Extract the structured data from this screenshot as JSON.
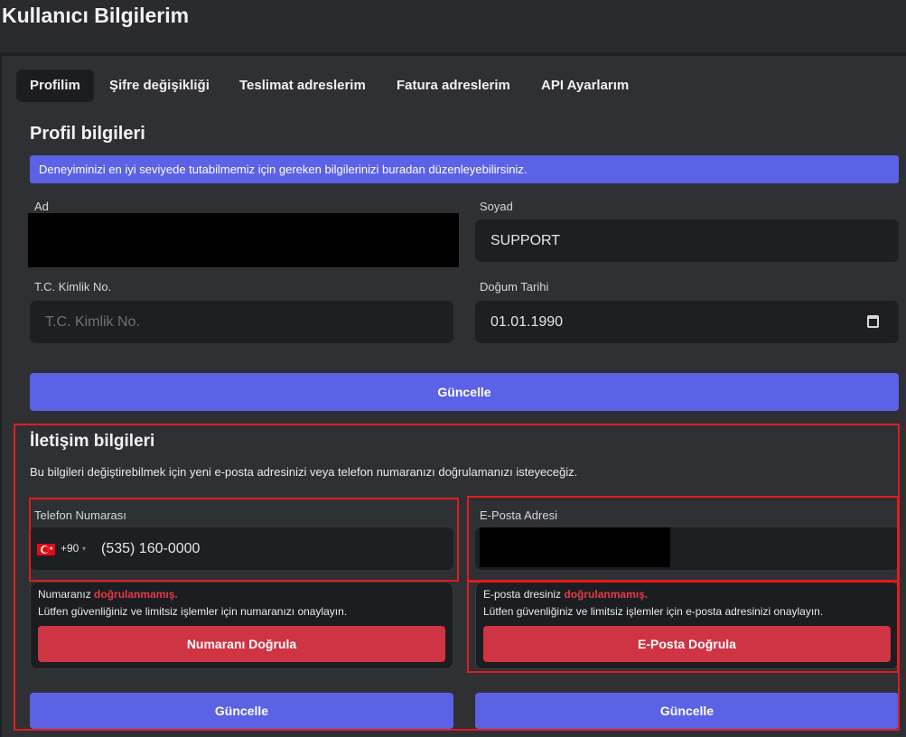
{
  "page": {
    "title": "Kullanıcı Bilgilerim"
  },
  "tabs": [
    {
      "label": "Profilim",
      "active": true
    },
    {
      "label": "Şifre değişikliği",
      "active": false
    },
    {
      "label": "Teslimat adreslerim",
      "active": false
    },
    {
      "label": "Fatura adreslerim",
      "active": false
    },
    {
      "label": "API Ayarlarım",
      "active": false
    }
  ],
  "profile": {
    "title": "Profil bilgileri",
    "info": "Deneyiminizi en iyi seviyede tutabilmemiz için gereken bilgilerinizi buradan düzenleyebilirsiniz.",
    "first_name": {
      "label": "Ad",
      "value": ""
    },
    "last_name": {
      "label": "Soyad",
      "value": "SUPPORT"
    },
    "tc_id": {
      "label": "T.C. Kimlik No.",
      "placeholder": "T.C. Kimlik No."
    },
    "birth_date": {
      "label": "Doğum Tarihi",
      "value": "01.01.1990",
      "icon": "calendar-icon"
    },
    "update_label": "Güncelle"
  },
  "contact": {
    "title": "İletişim bilgileri",
    "description": "Bu bilgileri değiştirebilmek için yeni e-posta adresinizi veya telefon numaranızı doğrulamanızı isteyeceğiz.",
    "phone": {
      "label": "Telefon Numarası",
      "country_icon": "turkey-flag-icon",
      "dial_code": "+90",
      "caret": "▾",
      "value": "(535) 160-0000",
      "status_prefix": "Numaranız",
      "status_warning": "doğrulanmamış.",
      "status_help": "Lütfen güvenliğiniz ve limitsiz işlemler için numaranızı onaylayın.",
      "verify_label": "Numaranı Doğrula",
      "update_label": "Güncelle"
    },
    "email": {
      "label": "E-Posta Adresi",
      "value": "",
      "status_prefix": "E-posta dresiniz",
      "status_warning": "doğrulanmamış.",
      "status_help": "Lütfen güvenliğiniz ve limitsiz işlemler için e-posta adresinizi onaylayın.",
      "verify_label": "E-Posta Doğrula",
      "update_label": "Güncelle"
    }
  },
  "colors": {
    "accent": "#5b62e6",
    "danger": "#cf3444",
    "warning_text": "#e23b4b",
    "highlight_frame": "#e01c1c"
  }
}
